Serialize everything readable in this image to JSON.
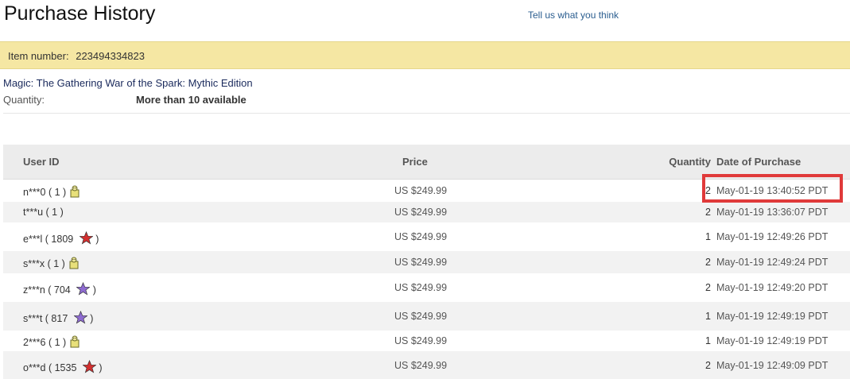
{
  "header": {
    "title": "Purchase History",
    "feedback_link": "Tell us what you think"
  },
  "item": {
    "label": "Item number:",
    "number": "223494334823",
    "title": "Magic: The Gathering War of the Spark: Mythic Edition",
    "quantity_label": "Quantity:",
    "quantity_value": "More than 10 available"
  },
  "table": {
    "headers": {
      "user_id": "User ID",
      "price": "Price",
      "quantity": "Quantity",
      "date": "Date of Purchase"
    },
    "rows": [
      {
        "user": "n***0",
        "score": "1",
        "icon": "new-user-icon",
        "price": "US $249.99",
        "qty": "2",
        "date": "May-01-19 13:40:52 PDT"
      },
      {
        "user": "t***u",
        "score": "1",
        "icon": "",
        "price": "US $249.99",
        "qty": "2",
        "date": "May-01-19 13:36:07 PDT"
      },
      {
        "user": "e***l",
        "score": "1809",
        "icon": "red-star-icon",
        "price": "US $249.99",
        "qty": "1",
        "date": "May-01-19 12:49:26 PDT"
      },
      {
        "user": "s***x",
        "score": "1",
        "icon": "new-user-icon",
        "price": "US $249.99",
        "qty": "2",
        "date": "May-01-19 12:49:24 PDT"
      },
      {
        "user": "z***n",
        "score": "704",
        "icon": "purple-star-icon",
        "price": "US $249.99",
        "qty": "2",
        "date": "May-01-19 12:49:20 PDT"
      },
      {
        "user": "s***t",
        "score": "817",
        "icon": "purple-star-icon",
        "price": "US $249.99",
        "qty": "1",
        "date": "May-01-19 12:49:19 PDT"
      },
      {
        "user": "2***6",
        "score": "1",
        "icon": "new-user-icon",
        "price": "US $249.99",
        "qty": "1",
        "date": "May-01-19 12:49:19 PDT"
      },
      {
        "user": "o***d",
        "score": "1535",
        "icon": "red-star-icon",
        "price": "US $249.99",
        "qty": "2",
        "date": "May-01-19 12:49:09 PDT"
      }
    ]
  },
  "colors": {
    "item_bar": "#f5e7a3",
    "highlight": "#e03a3a",
    "red_star": "#d32f2f",
    "purple_star": "#8e6bd1"
  }
}
